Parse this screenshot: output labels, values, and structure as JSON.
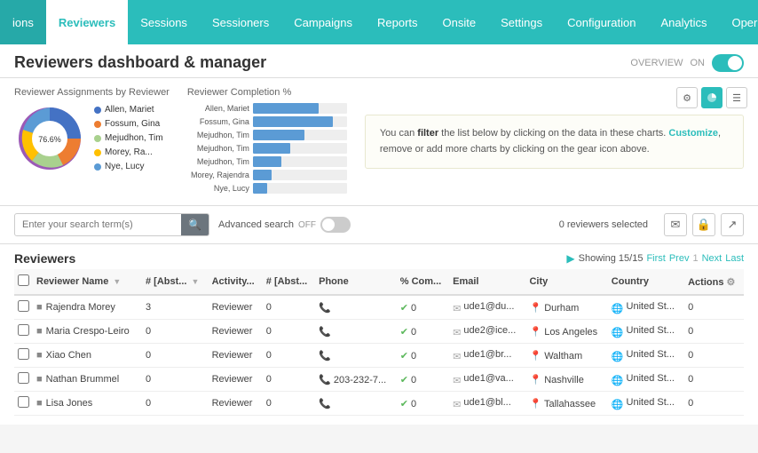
{
  "nav": {
    "items": [
      {
        "label": "ions",
        "active": false
      },
      {
        "label": "Reviewers",
        "active": true
      },
      {
        "label": "Sessions",
        "active": false
      },
      {
        "label": "Sessioners",
        "active": false
      },
      {
        "label": "Campaigns",
        "active": false
      },
      {
        "label": "Reports",
        "active": false
      },
      {
        "label": "Onsite",
        "active": false
      },
      {
        "label": "Settings",
        "active": false
      },
      {
        "label": "Configuration",
        "active": false
      },
      {
        "label": "Analytics",
        "active": false
      },
      {
        "label": "Operation",
        "active": false
      }
    ]
  },
  "header": {
    "title": "Reviewers dashboard & manager",
    "overview_label": "OVERVIEW",
    "on_label": "ON"
  },
  "charts": {
    "pie_title": "Reviewer Assignments by Reviewer",
    "pie_center": "76.6%",
    "pie_segments": [
      {
        "label": "Allen, Mariet",
        "color": "#4472c4",
        "pct": 15
      },
      {
        "label": "Fossum, Gina",
        "color": "#ed7d31",
        "pct": 10
      },
      {
        "label": "Mejudhon, Tim",
        "color": "#a9d18e",
        "pct": 8
      },
      {
        "label": "Morey, Ra...",
        "color": "#ffc000",
        "pct": 5
      },
      {
        "label": "Nye, Lucy",
        "color": "#5b9bd5",
        "pct": 3
      }
    ],
    "bar_title": "Reviewer Completion %",
    "bar_rows": [
      {
        "label": "Allen, Mariet",
        "value": 70
      },
      {
        "label": "Fossum, Gina",
        "value": 85
      },
      {
        "label": "Mejudhon, Tim",
        "value": 55
      },
      {
        "label": "Mejudhon, Tim",
        "value": 40
      },
      {
        "label": "Mejudhon, Tim",
        "value": 30
      },
      {
        "label": "Morey, Rajendra",
        "value": 20
      },
      {
        "label": "Nye, Lucy",
        "value": 15
      }
    ],
    "info_text_1": "You can ",
    "info_filter": "filter",
    "info_text_2": " the list below by clicking on the data in these charts. ",
    "info_customize": "Customize",
    "info_text_3": ", remove or add more charts by clicking on the gear icon above."
  },
  "search": {
    "placeholder": "Enter your search term(s)",
    "adv_label": "Advanced search",
    "off_label": "OFF",
    "selected_label": "0 reviewers selected"
  },
  "table": {
    "title": "Reviewers",
    "showing": "Showing 15/15",
    "pagination": {
      "first": "First",
      "prev": "Prev",
      "next": "Next",
      "last": "Last"
    },
    "columns": [
      {
        "label": "Reviewer Name",
        "sortable": true
      },
      {
        "label": "# [Abst...",
        "sortable": true
      },
      {
        "label": "Activity...",
        "sortable": false
      },
      {
        "label": "# [Abst...",
        "sortable": false
      },
      {
        "label": "Phone",
        "sortable": false
      },
      {
        "label": "% Com...",
        "sortable": false
      },
      {
        "label": "Email",
        "sortable": false
      },
      {
        "label": "City",
        "sortable": false
      },
      {
        "label": "Country",
        "sortable": false
      },
      {
        "label": "Actions",
        "sortable": false
      }
    ],
    "rows": [
      {
        "name": "Rajendra Morey",
        "abst1": "3",
        "activity": "Reviewer",
        "abst2": "0",
        "phone": "",
        "completion": "0",
        "email": "ude1@du...",
        "city": "Durham",
        "country": "United St...",
        "actions": "0"
      },
      {
        "name": "Maria Crespo-Leiro",
        "abst1": "0",
        "activity": "Reviewer",
        "abst2": "0",
        "phone": "",
        "completion": "0",
        "email": "ude2@ice...",
        "city": "Los Angeles",
        "country": "United St...",
        "actions": "0"
      },
      {
        "name": "Xiao Chen",
        "abst1": "0",
        "activity": "Reviewer",
        "abst2": "0",
        "phone": "",
        "completion": "0",
        "email": "ude1@br...",
        "city": "Waltham",
        "country": "United St...",
        "actions": "0"
      },
      {
        "name": "Nathan Brummel",
        "abst1": "0",
        "activity": "Reviewer",
        "abst2": "0",
        "phone": "203-232-7...",
        "completion": "0",
        "email": "ude1@va...",
        "city": "Nashville",
        "country": "United St...",
        "actions": "0"
      },
      {
        "name": "Lisa Jones",
        "abst1": "0",
        "activity": "Reviewer",
        "abst2": "0",
        "phone": "",
        "completion": "0",
        "email": "ude1@bl...",
        "city": "Tallahassee",
        "country": "United St...",
        "actions": "0"
      }
    ]
  }
}
